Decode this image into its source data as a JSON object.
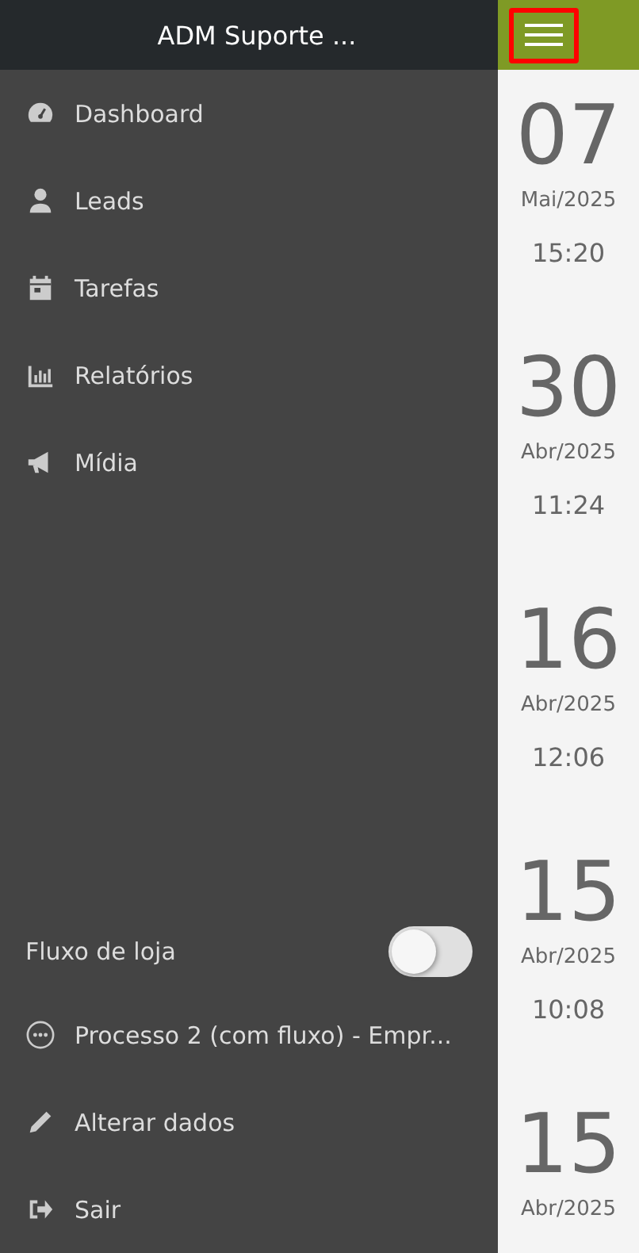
{
  "header": {
    "title": "ADM Suporte ..."
  },
  "menu": [
    {
      "kind": "dashboard",
      "label": "Dashboard"
    },
    {
      "kind": "user",
      "label": "Leads"
    },
    {
      "kind": "calendar",
      "label": "Tarefas"
    },
    {
      "kind": "chart",
      "label": "Relatórios"
    },
    {
      "kind": "megaphone",
      "label": "Mídia"
    }
  ],
  "store_flow": {
    "label": "Fluxo de loja",
    "on": false
  },
  "footer_items": [
    {
      "kind": "dots",
      "label": "Processo 2 (com fluxo) - Empr..."
    },
    {
      "kind": "pencil",
      "label": "Alterar dados"
    },
    {
      "kind": "exit",
      "label": "Sair"
    }
  ],
  "dates": [
    {
      "day": "07",
      "month": "Mai/2025",
      "time": "15:20"
    },
    {
      "day": "30",
      "month": "Abr/2025",
      "time": "11:24"
    },
    {
      "day": "16",
      "month": "Abr/2025",
      "time": "12:06"
    },
    {
      "day": "15",
      "month": "Abr/2025",
      "time": "10:08"
    },
    {
      "day": "15",
      "month": "Abr/2025"
    }
  ]
}
